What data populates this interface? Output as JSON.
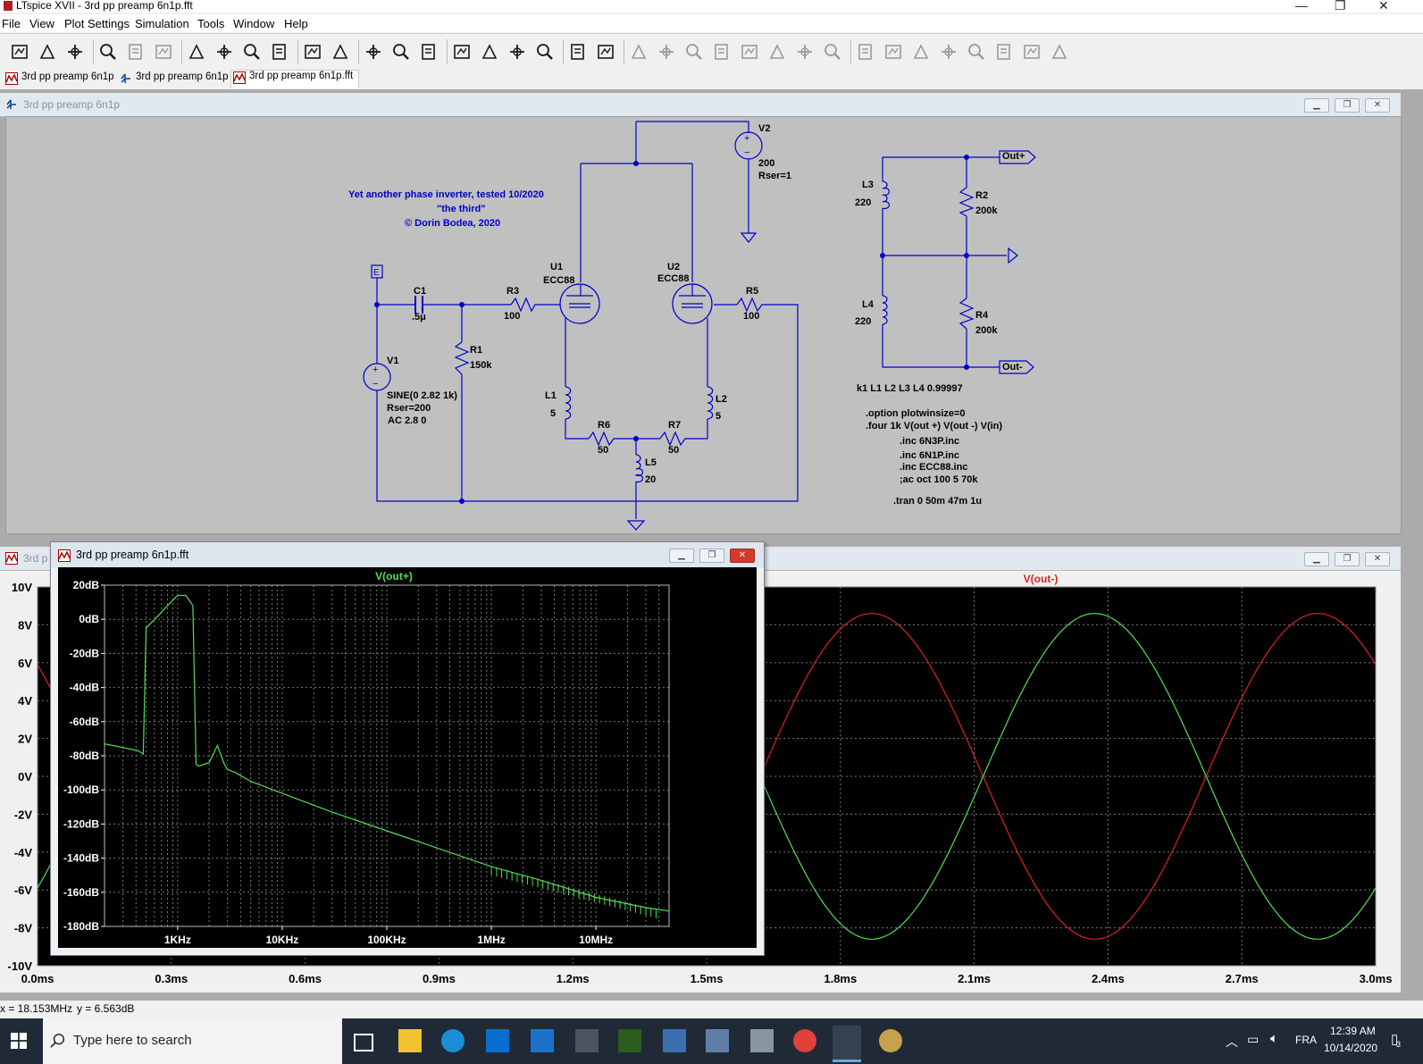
{
  "app": {
    "title": "LTspice XVII - 3rd pp preamp 6n1p.fft",
    "window_controls": [
      "—",
      "❐",
      "✕"
    ]
  },
  "menu": [
    "File",
    "View",
    "Plot Settings",
    "Simulation",
    "Tools",
    "Window",
    "Help"
  ],
  "toolbar_icons": [
    "run-icon",
    "open-icon",
    "save-icon",
    "settings-hammer-icon",
    "halt-icon",
    "pan-hand-icon",
    "zoom-in-icon",
    "zoom-fit-icon",
    "zoom-out-icon",
    "zoom-cancel-icon",
    "autorange-icon",
    "grid-icon",
    "tile-horizontal-icon",
    "cascade-icon",
    "tile-vertical-icon",
    "cut-icon",
    "copy-icon",
    "paste-icon",
    "find-icon",
    "print-icon",
    "print-setup-icon",
    "draw-wire-icon",
    "ground-icon",
    "label-net-icon",
    "resistor-icon",
    "capacitor-icon",
    "inductor-icon",
    "diode-icon",
    "component-icon",
    "move-icon",
    "drag-icon",
    "undo-icon",
    "redo-icon",
    "rotate-icon",
    "mirror-icon",
    "text-icon",
    "spice-directive-icon"
  ],
  "tabs": [
    {
      "label": "3rd pp preamp 6n1p",
      "icon": "waveform-icon"
    },
    {
      "label": "3rd pp preamp 6n1p",
      "icon": "schematic-icon"
    },
    {
      "label": "3rd pp preamp 6n1p.fft",
      "icon": "waveform-icon"
    }
  ],
  "schematic": {
    "title": "3rd pp preamp 6n1p",
    "comment_lines": [
      "Yet another phase inverter, tested 10/2020",
      "\"the third\"",
      "© Dorin Bodea, 2020"
    ],
    "labels": {
      "v2": "V2",
      "v2_val": "200",
      "v2_rser": "Rser=1",
      "u1": "U1",
      "u1_type": "ECC88",
      "u2": "U2",
      "u2_type": "ECC88",
      "c1": "C1",
      "c1_val": ".5μ",
      "r3": "R3",
      "r3_val": "100",
      "r1": "R1",
      "r1_val": "150k",
      "r5": "R5",
      "r5_val": "100",
      "v1": "V1",
      "v1_sine": "SINE(0 2.82 1k)",
      "v1_rser": "Rser=200",
      "v1_ac": "AC 2.8 0",
      "l1": "L1",
      "l1_val": "5",
      "l2": "L2",
      "l2_val": "5",
      "r6": "R6",
      "r6_val": "50",
      "r7": "R7",
      "r7_val": "50",
      "l5": "L5",
      "l5_val": "20",
      "l3": "L3",
      "l3_val": "220",
      "l4": "L4",
      "l4_val": "220",
      "r2": "R2",
      "r2_val": "200k",
      "r4": "R4",
      "r4_val": "200k",
      "out_plus": "Out+",
      "out_minus": "Out-",
      "in_flag": "E"
    },
    "directives": [
      "k1 L1 L2 L3 L4 0.99997",
      ".option plotwinsize=0",
      ".four 1k V(out +) V(out -) V(in)",
      ".inc 6N3P.inc",
      ".inc 6N1P.inc",
      ".inc ECC88.inc",
      ";ac oct 100 5 70k",
      ".tran 0 50m 47m 1u"
    ]
  },
  "transient_window": {
    "title": "3rd p",
    "trace_label": "V(out-)"
  },
  "fft_window": {
    "title": "3rd pp preamp 6n1p.fft",
    "trace_label": "V(out+)"
  },
  "status": {
    "x": "x = 18.153MHz",
    "y": "y = 6.563dB"
  },
  "taskbar": {
    "search_placeholder": "Type here to search",
    "lang": "FRA",
    "time": "12:39 AM",
    "date": "10/14/2020",
    "notif_count": "3"
  },
  "colors": {
    "wire": "#0000cc",
    "green_trace": "#55dd55",
    "red_trace": "#dd2222",
    "plot_bg": "#000000",
    "grid": "#7a7a7a"
  },
  "chart_data": [
    {
      "type": "line",
      "title": "V(out+)",
      "xlabel": "",
      "ylabel": "",
      "x_scale": "log",
      "x_ticks": [
        "1KHz",
        "10KHz",
        "100KHz",
        "1MHz",
        "10MHz"
      ],
      "y_ticks": [
        "20dB",
        "0dB",
        "-20dB",
        "-40dB",
        "-60dB",
        "-80dB",
        "-100dB",
        "-120dB",
        "-140dB",
        "-160dB",
        "-180dB"
      ],
      "xlim_hz": [
        200,
        50000000
      ],
      "ylim_db": [
        -180,
        20
      ],
      "grid": true,
      "series": [
        {
          "name": "V(out+)",
          "color": "#55dd55",
          "x": [
            200,
            420,
            470,
            500,
            650,
            800,
            1000,
            1200,
            1400,
            1500,
            1600,
            2000,
            2400,
            2800,
            3000,
            3600,
            5000,
            10000,
            30000,
            100000,
            300000,
            1000000,
            3000000,
            10000000,
            30000000,
            50000000
          ],
          "y": [
            -73,
            -77,
            -79,
            -5,
            2,
            8,
            14,
            14,
            8,
            -85,
            -86,
            -84,
            -74,
            -85,
            -88,
            -90,
            -95,
            -102,
            -113,
            -124,
            -134,
            -145,
            -153,
            -163,
            -169,
            -171
          ]
        }
      ]
    },
    {
      "type": "line",
      "title": "V(out-)",
      "xlabel": "",
      "ylabel": "",
      "x_ticks": [
        "0.0ms",
        "0.3ms",
        "0.6ms",
        "0.9ms",
        "1.2ms",
        "1.5ms",
        "1.8ms",
        "2.1ms",
        "2.4ms",
        "2.7ms",
        "3.0ms"
      ],
      "y_ticks": [
        "10V",
        "8V",
        "6V",
        "4V",
        "2V",
        "0V",
        "-2V",
        "-4V",
        "-6V",
        "-8V",
        "-10V"
      ],
      "xlim_ms": [
        0,
        3
      ],
      "ylim_v": [
        -10,
        10
      ],
      "grid": true,
      "series": [
        {
          "name": "V(out-)",
          "color": "#dd2222",
          "waveform": "sine",
          "freq_hz": 1000,
          "amplitude_v": 8.6,
          "phase_deg": 180
        },
        {
          "color": "#55dd55",
          "waveform": "sine",
          "freq_hz": 1000,
          "amplitude_v": 8.6,
          "phase_deg": 0
        }
      ]
    }
  ]
}
